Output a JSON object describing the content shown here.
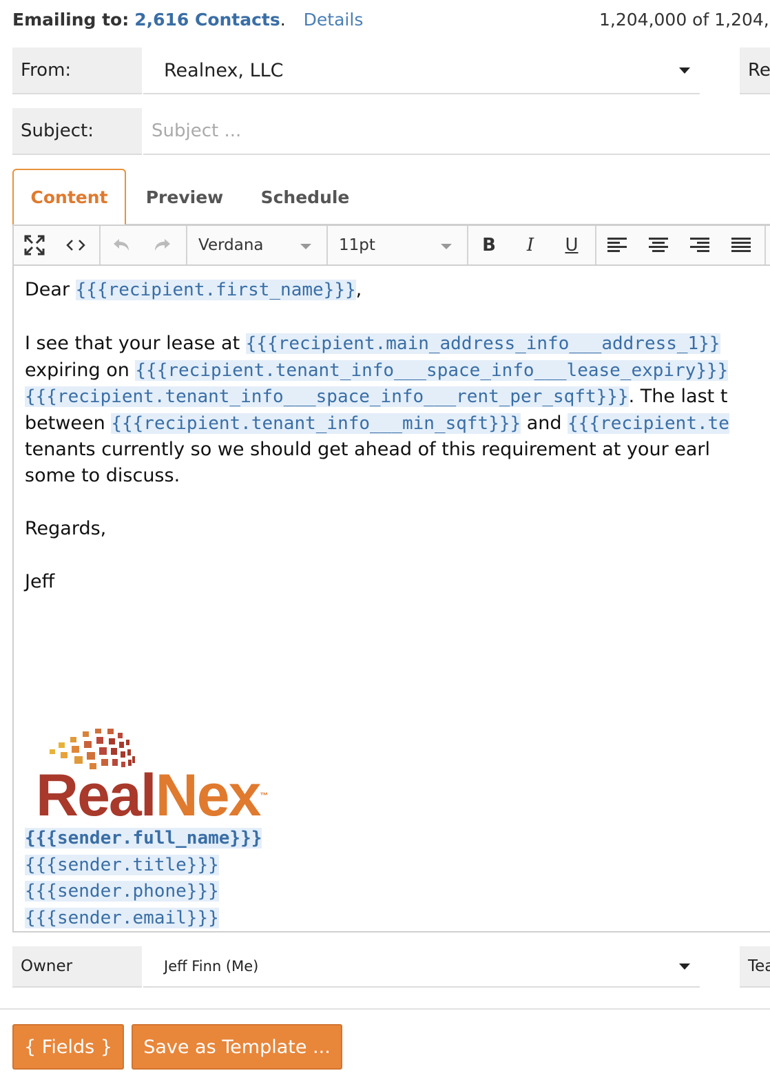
{
  "header": {
    "emailing_label": "Emailing to:",
    "contacts_link": "2,616 Contacts",
    "period": ".",
    "details_link": "Details",
    "count_text": "1,204,000 of 1,204,00"
  },
  "from": {
    "label": "From:",
    "value": "Realnex, LLC",
    "side_label": "Re"
  },
  "subject": {
    "label": "Subject:",
    "placeholder": "Subject ..."
  },
  "tabs": [
    {
      "label": "Content",
      "active": true
    },
    {
      "label": "Preview",
      "active": false
    },
    {
      "label": "Schedule",
      "active": false
    }
  ],
  "toolbar": {
    "font": "Verdana",
    "size": "11pt",
    "bold": "B",
    "italic": "I",
    "underline": "U"
  },
  "body": {
    "greeting_pre": "Dear ",
    "greeting_token": "{{{recipient.first_name}}}",
    "greeting_post": ",",
    "p1_l1_text": "I see that your lease at ",
    "p1_l1_token": "{{{recipient.main_address_info___address_1}}",
    "p1_l2_text": "expiring on ",
    "p1_l2_token": "{{{recipient.tenant_info___space_info___lease_expiry}}}",
    "p1_l3_token": "{{{recipient.tenant_info___space_info___rent_per_sqft}}}",
    "p1_l3_text": ". The last t",
    "p1_l4_text": "between ",
    "p1_l4_token": "{{{recipient.tenant_info___min_sqft}}}",
    "p1_l4_and": " and ",
    "p1_l4_token2": "{{{recipient.te",
    "p1_l5_text": "tenants currently so we should get ahead of this requirement at your earl",
    "p1_l6_text": "some to discuss.",
    "regards": "Regards,",
    "signature_name": "Jeff",
    "logo_text_1": "Real",
    "logo_text_2": "Nex",
    "logo_tm": "™",
    "sender_full_name": "{{{sender.full_name}}}",
    "sender_title": "{{{sender.title}}}",
    "sender_phone": "{{{sender.phone}}}",
    "sender_email": "{{{sender.email}}}"
  },
  "owner": {
    "label": "Owner",
    "value": "Jeff Finn (Me)",
    "side_label": "Tea"
  },
  "buttons": {
    "fields": "{ Fields }",
    "save_template": "Save as Template ..."
  },
  "colors": {
    "accent": "#e8863a",
    "link": "#3a6ea5",
    "token_bg": "#e3eef9",
    "logo_red": "#a8392b",
    "logo_orange": "#e07a2e"
  }
}
